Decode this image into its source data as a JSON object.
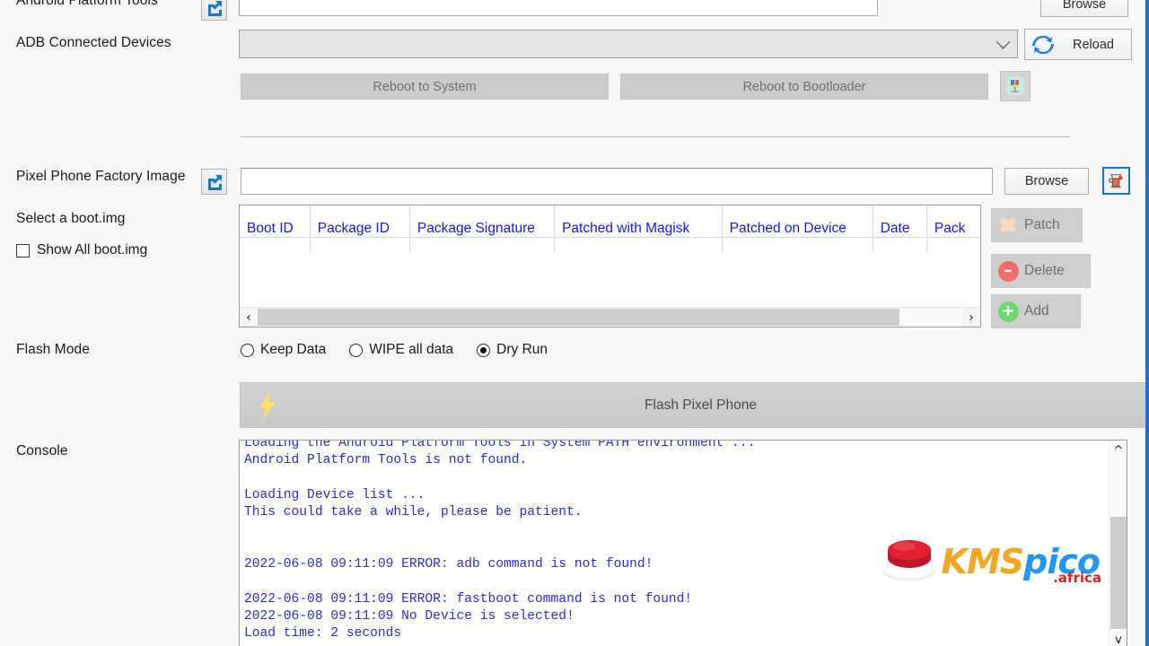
{
  "labels": {
    "android_platform_tools": "Android Platform Tools",
    "adb_connected_devices": "ADB Connected Devices",
    "pixel_factory_image": "Pixel Phone Factory Image",
    "select_bootimg": "Select a boot.img",
    "show_all_bootimg": "Show All boot.img",
    "flash_mode": "Flash Mode",
    "console": "Console"
  },
  "buttons": {
    "browse_top": "Browse",
    "reload": "Reload",
    "reboot_to_system": "Reboot to System",
    "reboot_to_bootloader": "Reboot to Bootloader",
    "browse_image": "Browse",
    "patch": "Patch",
    "delete": "Delete",
    "add": "Add",
    "flash": "Flash Pixel Phone"
  },
  "inputs": {
    "platform_tools_path": "",
    "factory_image_path": "",
    "adb_device_selected": ""
  },
  "table": {
    "columns": [
      "Boot ID",
      "Package ID",
      "Package Signature",
      "Patched with Magisk",
      "Patched on Device",
      "Date",
      "Pack"
    ],
    "rows": []
  },
  "flash_mode": {
    "options": [
      {
        "label": "Keep Data",
        "selected": false
      },
      {
        "label": "WIPE all data",
        "selected": false
      },
      {
        "label": "Dry Run",
        "selected": true
      }
    ]
  },
  "checkbox": {
    "show_all_bootimg_checked": false
  },
  "console_output": "Loading the Android Platform Tools in System PATH environment ...\nAndroid Platform Tools is not found.\n\nLoading Device list ...\nThis could take a while, please be patient.\n\n\n2022-06-08 09:11:09 ERROR: adb command is not found!\n\n2022-06-08 09:11:09 ERROR: fastboot command is not found!\n2022-06-08 09:11:09 No Device is selected!\nLoad time: 2 seconds",
  "watermark": {
    "kms": "KMS",
    "pico": "pico",
    "tld": ".africa"
  },
  "icons": {
    "platform_tools_launch": "external-link-icon",
    "factory_image_launch": "external-link-icon",
    "reload": "refresh-icon",
    "scrcpy": "device-mirror-icon",
    "grinder": "grinder-icon",
    "flash_bolt": "lightning-bolt-icon",
    "patch": "bandage-icon",
    "delete": "minus-circle-icon",
    "add": "plus-circle-icon"
  },
  "colors": {
    "table_header": "#1414ff",
    "console_text": "#2a2ae0",
    "accent_blue": "#1277d4",
    "bolt": "#ffe066",
    "delete_red": "#f26d6d",
    "add_green": "#6fd96f",
    "patch_peach": "#fbd9bd"
  },
  "scrollbars": {
    "table_h_left_arrow": "‹",
    "table_h_right_arrow": "›",
    "console_up_arrow": "^",
    "console_down_arrow": "v"
  }
}
